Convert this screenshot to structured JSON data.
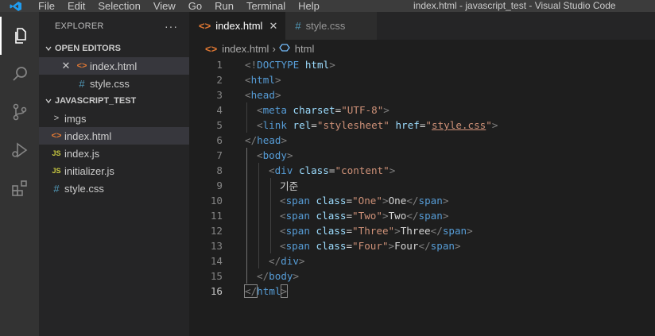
{
  "window": {
    "title": "index.html - javascript_test - Visual Studio Code"
  },
  "menu": [
    "File",
    "Edit",
    "Selection",
    "View",
    "Go",
    "Run",
    "Terminal",
    "Help"
  ],
  "activity_bar": [
    "explorer-icon",
    "search-icon",
    "source-control-icon",
    "run-debug-icon",
    "extensions-icon"
  ],
  "explorer": {
    "header": "EXPLORER",
    "more": "···",
    "open_editors": {
      "title": "OPEN EDITORS",
      "items": [
        {
          "name": "index.html",
          "icon": "<>"
        },
        {
          "name": "style.css",
          "icon": "#"
        }
      ]
    },
    "project": {
      "title": "JAVASCRIPT_TEST",
      "items": [
        {
          "name": "imgs",
          "icon": ">"
        },
        {
          "name": "index.html",
          "icon": "<>"
        },
        {
          "name": "index.js",
          "icon": "JS"
        },
        {
          "name": "initializer.js",
          "icon": "JS"
        },
        {
          "name": "style.css",
          "icon": "#"
        }
      ]
    }
  },
  "tabs": [
    {
      "label": "index.html",
      "icon": "<>",
      "close": "✕"
    },
    {
      "label": "style.css",
      "icon": "#"
    }
  ],
  "breadcrumb": {
    "file": "index.html",
    "sep": "›",
    "symbol": "html"
  },
  "code": {
    "line_numbers": [
      "1",
      "2",
      "3",
      "4",
      "5",
      "6",
      "7",
      "8",
      "9",
      "10",
      "11",
      "12",
      "13",
      "14",
      "15",
      "16"
    ],
    "current_line": 16,
    "text": {
      "doctype_open": "<!",
      "doctype_kw": "DOCTYPE",
      "doctype_html": "html",
      "doctype_close": ">",
      "tag_html": "html",
      "tag_head": "head",
      "tag_meta": "meta",
      "tag_link": "link",
      "tag_body": "body",
      "tag_div": "div",
      "tag_span": "span",
      "attr_charset": "charset",
      "attr_rel": "rel",
      "attr_href": "href",
      "attr_class": "class",
      "val_utf8": "\"UTF-8\"",
      "val_stylesheet": "\"stylesheet\"",
      "val_stylecss": "style.css",
      "val_content": "\"content\"",
      "val_one": "\"One\"",
      "val_two": "\"Two\"",
      "val_three": "\"Three\"",
      "val_four": "\"Four\"",
      "text_korean": "기준",
      "text_one": "One",
      "text_two": "Two",
      "text_three": "Three",
      "text_four": "Four",
      "lt": "<",
      "gt": ">",
      "lts": "</",
      "eq": "=",
      "q": "\""
    }
  },
  "colors": {
    "tag": "#569cd6",
    "attr": "#9cdcfe",
    "string": "#ce9178",
    "bracket": "#808080",
    "text": "#d4d4d4",
    "html_icon": "#e37933",
    "css_icon": "#519aba",
    "js_icon": "#cbcb41",
    "accent": "#0078d4"
  }
}
